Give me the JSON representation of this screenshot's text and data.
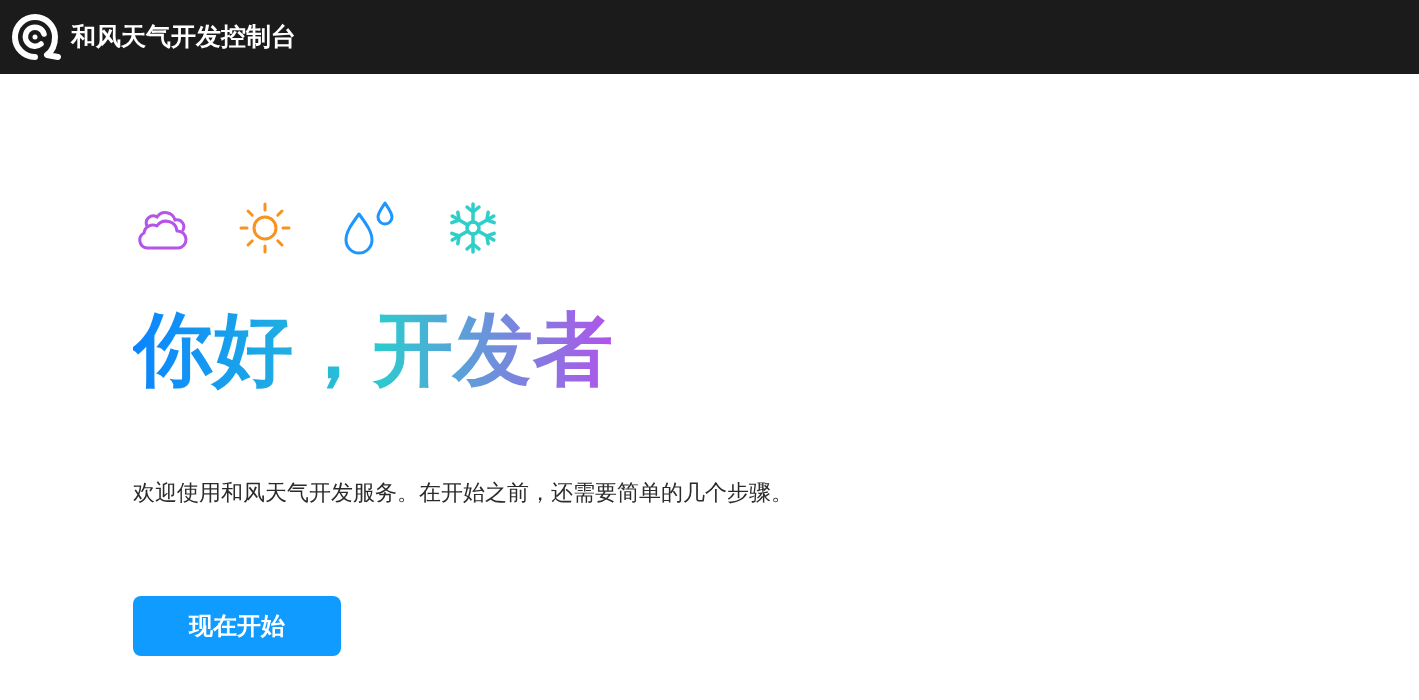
{
  "header": {
    "title": "和风天气开发控制台"
  },
  "hero": {
    "heading": "你好，开发者",
    "intro": "欢迎使用和风天气开发服务。在开始之前，还需要简单的几个步骤。",
    "button": "现在开始"
  }
}
